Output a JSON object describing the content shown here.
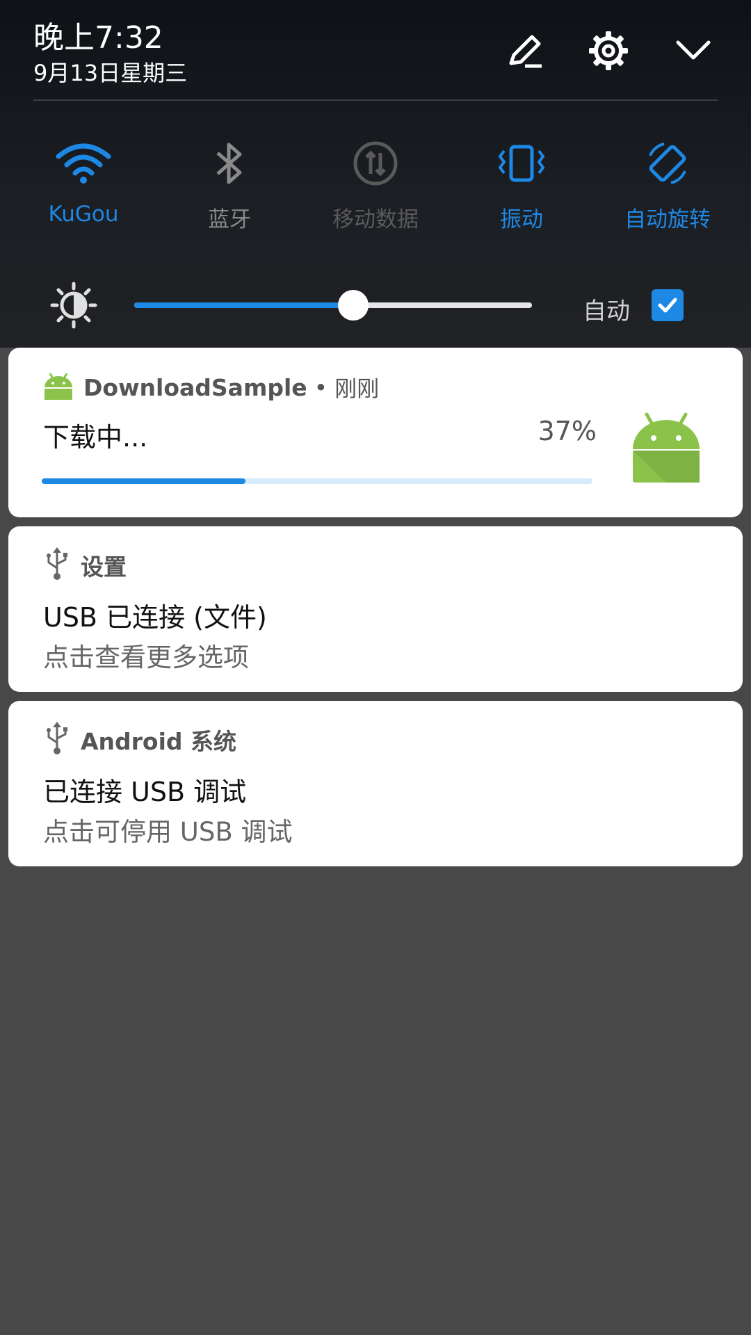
{
  "header": {
    "time": "晚上7:32",
    "date": "9月13日星期三",
    "edit_icon": "pencil-icon",
    "settings_icon": "gear-icon",
    "collapse_icon": "chevron-down-icon"
  },
  "quick_settings": [
    {
      "label": "KuGou",
      "icon": "wifi-icon",
      "active": true
    },
    {
      "label": "蓝牙",
      "icon": "bluetooth-icon",
      "active": false
    },
    {
      "label": "移动数据",
      "icon": "mobile-data-icon",
      "active": false
    },
    {
      "label": "振动",
      "icon": "vibrate-icon",
      "active": true
    },
    {
      "label": "自动旋转",
      "icon": "auto-rotate-icon",
      "active": true
    }
  ],
  "brightness": {
    "level": 0.55,
    "auto_label": "自动",
    "auto_checked": true
  },
  "notifications": [
    {
      "app": "DownloadSample",
      "time": "刚刚",
      "title": "下载中...",
      "progress_label": "37%",
      "progress": 0.37,
      "icon": "android-icon"
    },
    {
      "app": "设置",
      "title": "USB 已连接 (文件)",
      "subtitle": "点击查看更多选项",
      "icon": "usb-icon"
    },
    {
      "app": "Android 系统",
      "title": "已连接 USB 调试",
      "subtitle": "点击可停用 USB 调试",
      "icon": "usb-icon"
    }
  ],
  "colors": {
    "accent": "#1e88e5",
    "inactive": "#8a8a8a",
    "disabled": "#5a5a5a",
    "android_green": "#8bc34a"
  }
}
